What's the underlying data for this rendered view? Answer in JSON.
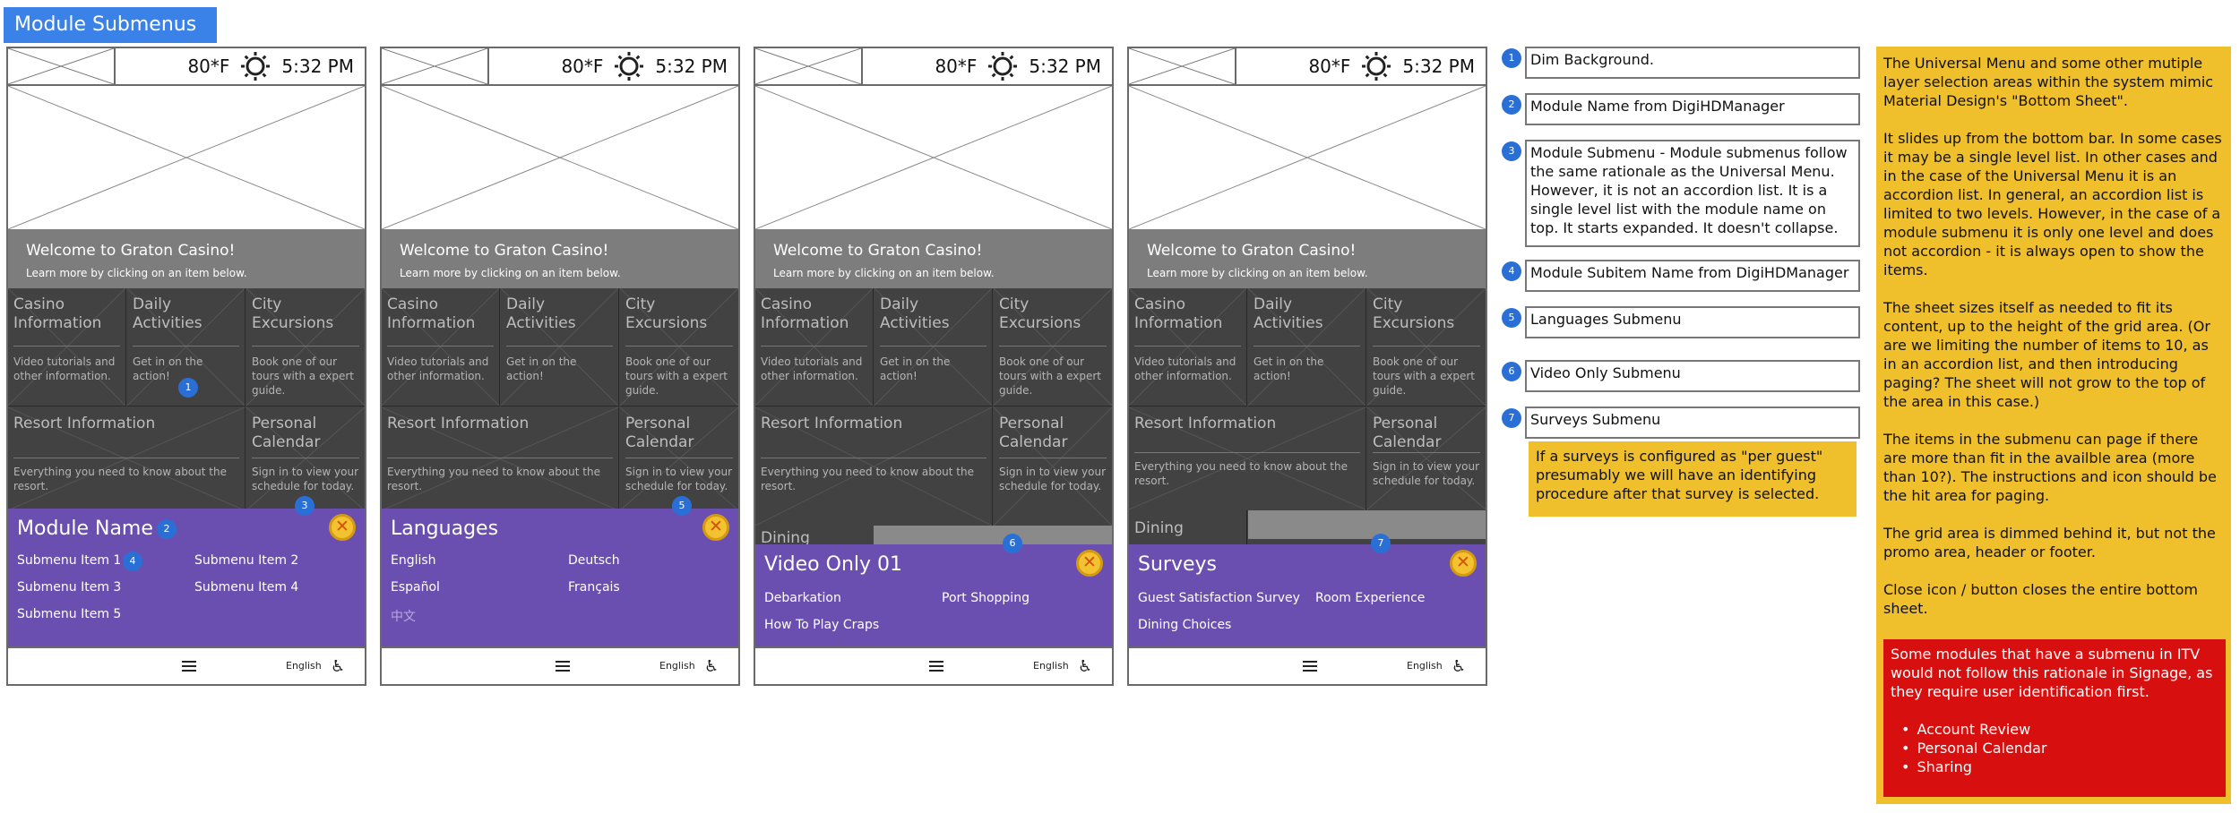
{
  "page_title": "Module Submenus",
  "topbar": {
    "temperature": "80*F",
    "time": "5:32 PM"
  },
  "welcome": {
    "title": "Welcome to Graton Casino!",
    "subtitle": "Learn more by clicking on an item below."
  },
  "tiles": {
    "casino": {
      "title": "Casino Information",
      "desc": "Video tutorials and other information."
    },
    "daily": {
      "title": "Daily Activities",
      "desc": "Get in on the action!"
    },
    "city": {
      "title": "City Excursions",
      "desc": "Book one of our tours with a expert guide."
    },
    "resort": {
      "title": "Resort Information",
      "desc": "Everything you need to know about the resort."
    },
    "personal": {
      "title": "Personal Calendar",
      "desc": "Sign in to view your schedule for today."
    },
    "dining": {
      "title": "Dining"
    }
  },
  "bottombar": {
    "language": "English"
  },
  "phones": [
    {
      "sheet_title": "Module Name",
      "items": [
        "Submenu Item 1",
        "Submenu Item 2",
        "Submenu Item 3",
        "Submenu Item 4",
        "Submenu Item 5"
      ]
    },
    {
      "sheet_title": "Languages",
      "items": [
        "English",
        "Deutsch",
        "Español",
        "Français",
        "中文"
      ]
    },
    {
      "sheet_title": "Video Only 01",
      "items": [
        "Debarkation",
        "Port Shopping",
        "How To Play Craps"
      ]
    },
    {
      "sheet_title": "Surveys",
      "items": [
        "Guest Satisfaction Survey",
        "Room Experience",
        "Dining Choices"
      ]
    }
  ],
  "badges": [
    "1",
    "2",
    "3",
    "4",
    "5",
    "6",
    "7"
  ],
  "notes": [
    {
      "num": "1",
      "text": "Dim Background."
    },
    {
      "num": "2",
      "text": "Module Name from DigiHDManager"
    },
    {
      "num": "3",
      "text": "Module Submenu - Module submenus follow the same rationale as the Universal Menu.  However, it is not an accordion list.  It is a single level list with the module name on top.  It starts expanded.  It doesn't collapse."
    },
    {
      "num": "4",
      "text": "Module Subitem Name from DigiHDManager"
    },
    {
      "num": "5",
      "text": "Languages Submenu"
    },
    {
      "num": "6",
      "text": "Video Only Submenu"
    },
    {
      "num": "7",
      "text": "Surveys Submenu"
    }
  ],
  "surveys_note": "If a surveys is configured as \"per guest\" presumably we will have an identifying procedure after that survey is selected.",
  "side_note": {
    "paragraphs": [
      "The Universal Menu and some other mutiple layer selection areas within the system mimic Material Design's \"Bottom Sheet\".",
      "It slides up from the bottom bar.  In some cases it may be a single level list.  In other cases and in the case of the Universal Menu it is an accordion list.  In general, an accordion list is limited to two levels.  However, in the case of a module submenu it is only one level and does not accordion - it is always open to show the items.",
      "The sheet sizes itself as needed to fit its content, up to the height of the grid area.  (Or are we limiting the number of items to 10, as in an accordion list, and then introducing paging?  The sheet will not grow to the top of the area in this case.)",
      "The items in the submenu can page if there are more than fit in the availble area (more than 10?).  The instructions and icon should be the hit area for paging.",
      "The grid area is dimmed behind it, but not the promo area, header or footer.",
      "Close icon / button closes the entire bottom sheet."
    ],
    "warning": "Some modules that have a submenu in ITV would not follow this rationale in Signage, as they require user identification first.",
    "warning_items": [
      "Account Review",
      "Personal Calendar",
      "Sharing"
    ]
  },
  "colors": {
    "sheet": "#6a4fb0",
    "sticky": "#f0bf2c",
    "warning": "#d70f0f",
    "badge": "#2a6fd6",
    "title_bar": "#3b82e8"
  },
  "icons": {
    "weather": "sun-icon",
    "close": "close-icon",
    "menu": "hamburger-menu-icon",
    "accessibility": "wheelchair-icon"
  }
}
